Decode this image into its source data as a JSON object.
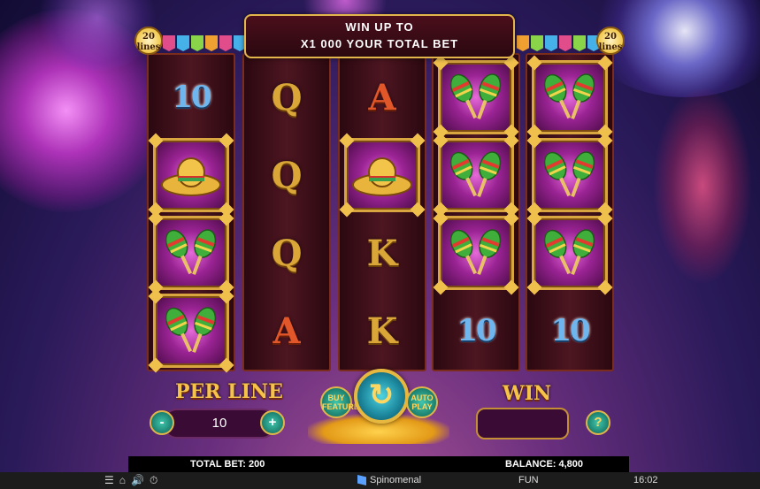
{
  "banner": {
    "line1": "WIN UP TO",
    "line2": "X1 000 YOUR TOTAL BET"
  },
  "lines_badge": {
    "number": "20",
    "word": "lines"
  },
  "reels": [
    [
      "10",
      "sombrero",
      "maracas",
      "maracas"
    ],
    [
      "Q",
      "Q",
      "Q",
      "A"
    ],
    [
      "A",
      "sombrero",
      "K",
      "K"
    ],
    [
      "maracas",
      "maracas",
      "maracas",
      "10"
    ],
    [
      "maracas",
      "maracas",
      "maracas",
      "10"
    ]
  ],
  "controls": {
    "per_line_label": "PER LINE",
    "per_line_value": "10",
    "minus": "-",
    "plus": "+",
    "buy_feature": "BUY FEATURE",
    "auto_play": "AUTO PLAY",
    "win_label": "WIN",
    "win_value": "",
    "help": "?"
  },
  "status": {
    "total_bet": "TOTAL BET: 200",
    "balance": "BALANCE: 4,800"
  },
  "taskbar": {
    "brand": "Spinomenal",
    "mode": "FUN",
    "time": "16:02"
  },
  "colors": {
    "gold": "#f5c24a",
    "teal": "#3fc6ad",
    "reel_bg": "#4d1621",
    "symbol_frame": "#d8a540"
  },
  "icons": [
    "menu-icon",
    "home-icon",
    "sound-icon",
    "speed-icon",
    "spin-arrow-icon"
  ]
}
